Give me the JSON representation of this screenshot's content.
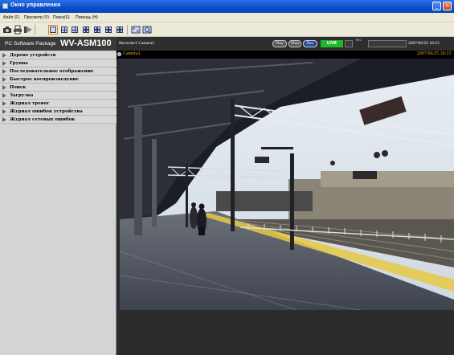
{
  "window": {
    "title": "Окно управления",
    "minimize": "_",
    "close": "×"
  },
  "menu": [
    "Файл (F)",
    "Просмотр (V)",
    "Поиск(S)",
    "Помощь (H)"
  ],
  "toolbar_icons": [
    "camera-icon",
    "printer-icon",
    "record-icon",
    "layout-1-icon",
    "layout-4-icon",
    "layout-4-alt-icon",
    "layout-9-icon",
    "layout-9-alt-icon",
    "layout-16-icon",
    "fullscreen-icon",
    "zoom-icon"
  ],
  "product": {
    "package": "PC Software Package",
    "model": "WV-ASM100"
  },
  "sidebar": {
    "items": [
      "Дерево устройств",
      "Группа",
      "Последовательное отображение",
      "Быстрое воспроизведение",
      "Поиск",
      "Загрузка",
      "Журнал тревог",
      "Журнал ошибок устройства",
      "Журнал сетевых ошибок"
    ]
  },
  "status": {
    "recorder": "Recorder1 Camera1",
    "buttons": [
      "Play",
      "Stop",
      "Rec"
    ],
    "live": "LIVE",
    "rec_small": "REC",
    "datetime": "2007/06/25 10:15"
  },
  "camera": {
    "name": "Camera1",
    "timestamp": "2007/06/25 10:15:"
  },
  "colors": {
    "accent": "#f2a127",
    "live": "#1fb82b",
    "titlebar": "#0a4fc8"
  }
}
